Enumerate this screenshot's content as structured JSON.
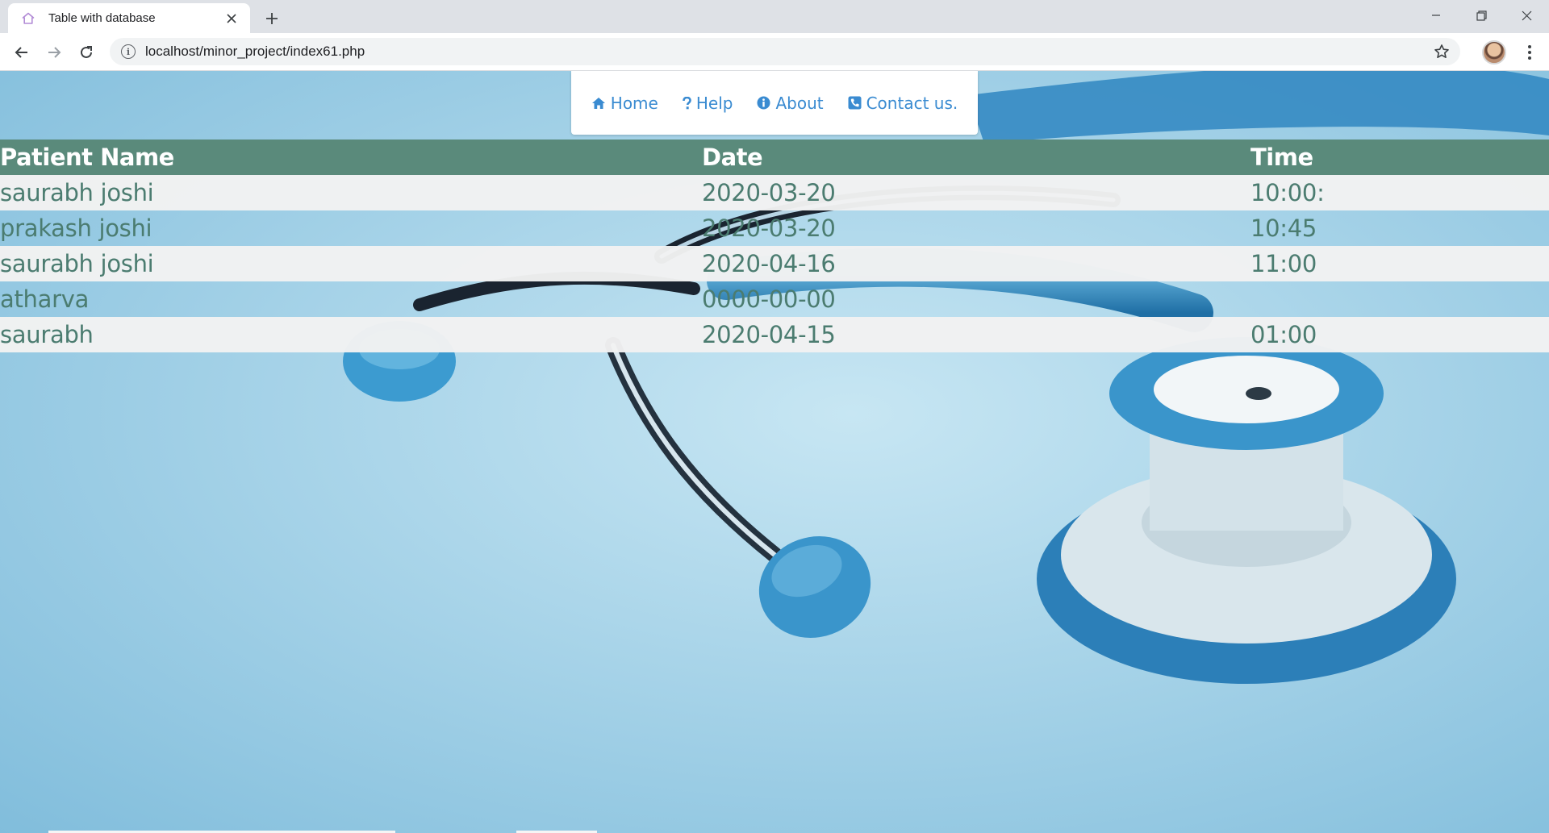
{
  "browser": {
    "tab_title": "Table with database",
    "url": "localhost/minor_project/index61.php"
  },
  "nav": {
    "items": [
      {
        "label": "Home",
        "icon": "home-icon"
      },
      {
        "label": "Help",
        "icon": "question-icon"
      },
      {
        "label": "About",
        "icon": "info-icon"
      },
      {
        "label": "Contact us.",
        "icon": "phone-icon"
      }
    ]
  },
  "table": {
    "headers": [
      "Patient Name",
      "Date",
      "Time"
    ],
    "rows": [
      [
        "saurabh joshi",
        "2020-03-20",
        "10:00:"
      ],
      [
        "prakash joshi",
        "2020-03-20",
        "10:45"
      ],
      [
        "saurabh joshi",
        "2020-04-16",
        "11:00"
      ],
      [
        "atharva",
        "0000-00-00",
        ""
      ],
      [
        "saurabh",
        "2020-04-15",
        "01:00"
      ]
    ]
  },
  "colors": {
    "header_bg": "#5a8a7b",
    "cell_text": "#4b7c70",
    "nav_link": "#3a8bd1",
    "row_light": "#f2f2f2"
  }
}
